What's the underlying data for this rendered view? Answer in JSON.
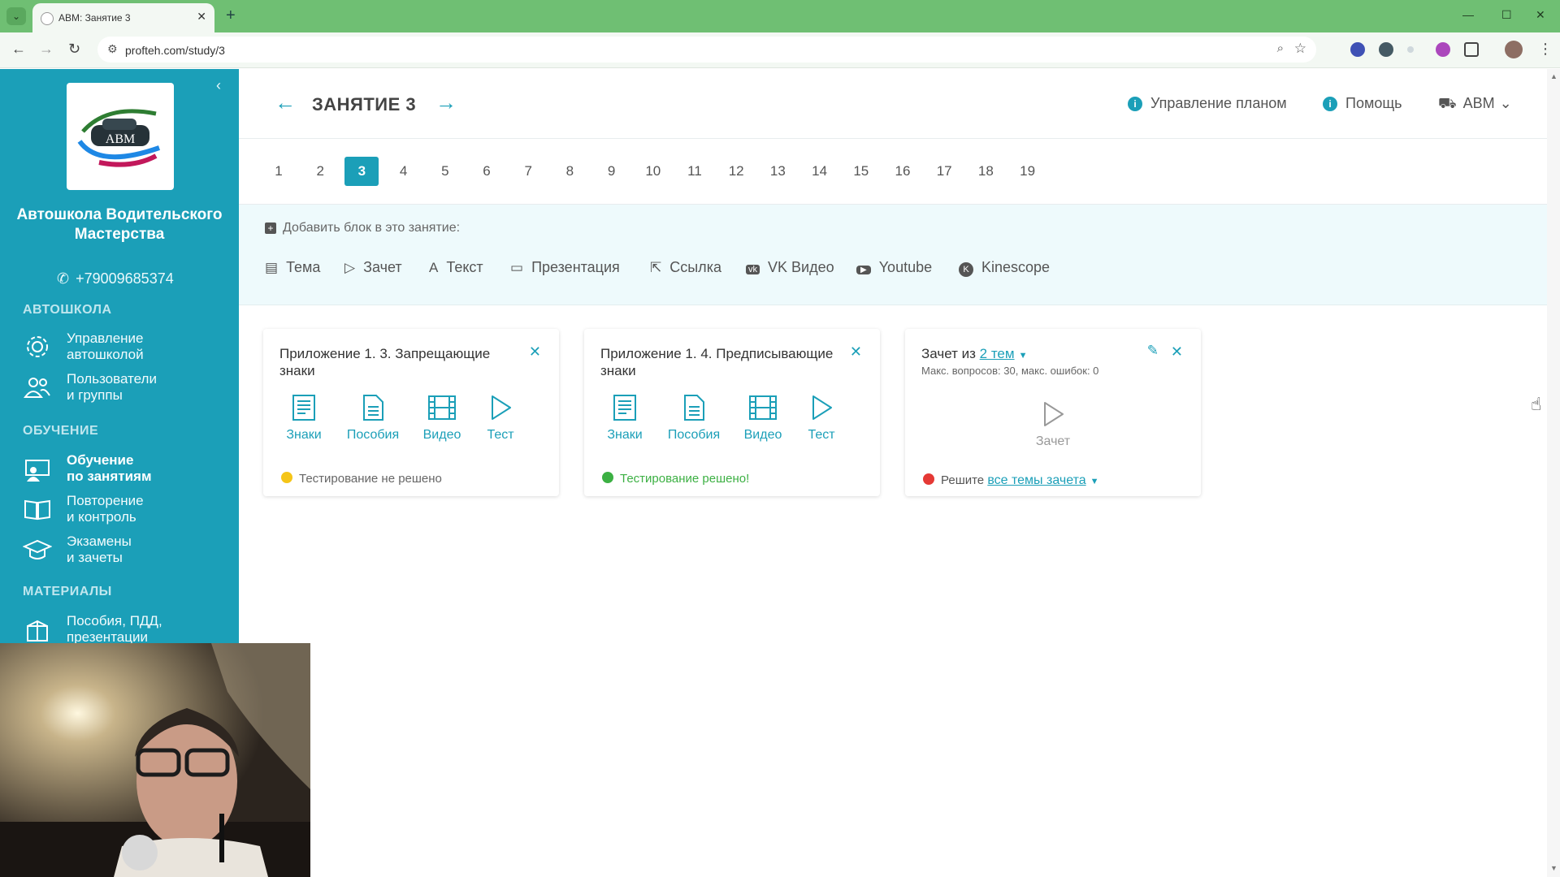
{
  "browser": {
    "tab_title": "АВМ: Занятие 3",
    "url": "profteh.com/study/3"
  },
  "sidebar": {
    "logo_text": "АВМ",
    "school_name": "Автошкола Водительского Мастерства",
    "phone": "+79009685374",
    "sections": [
      {
        "title": "АВТОШКОЛА",
        "items": [
          {
            "label": "Управление\nавтошколой",
            "icon": "gear-icon"
          },
          {
            "label": "Пользователи\nи группы",
            "icon": "users-icon"
          }
        ]
      },
      {
        "title": "ОБУЧЕНИЕ",
        "items": [
          {
            "label": "Обучение\nпо занятиям",
            "icon": "teacher-icon",
            "active": true
          },
          {
            "label": "Повторение\nи контроль",
            "icon": "book-open-icon"
          },
          {
            "label": "Экзамены\nи зачеты",
            "icon": "graduation-cap-icon"
          }
        ]
      },
      {
        "title": "МАТЕРИАЛЫ",
        "items": [
          {
            "label": "Пособия, ПДД,\nпрезентации",
            "icon": "box-icon"
          }
        ]
      }
    ]
  },
  "header": {
    "lesson_title": "ЗАНЯТИЕ 3",
    "plan_link": "Управление планом",
    "help_link": "Помощь",
    "account": "АВМ"
  },
  "pager": {
    "pages": [
      "1",
      "2",
      "3",
      "4",
      "5",
      "6",
      "7",
      "8",
      "9",
      "10",
      "11",
      "12",
      "13",
      "14",
      "15",
      "16",
      "17",
      "18",
      "19"
    ],
    "current": "3"
  },
  "add_block": {
    "title": "Добавить блок в это занятие:",
    "types": [
      "Тема",
      "Зачет",
      "Текст",
      "Презентация",
      "Ссылка",
      "VK Видео",
      "Youtube",
      "Kinescope"
    ]
  },
  "cards": [
    {
      "title": "Приложение 1. 3. Запрещающие знаки",
      "materials": [
        "Знаки",
        "Пособия",
        "Видео",
        "Тест"
      ],
      "status": "Тестирование не решено",
      "status_color": "#f5c518"
    },
    {
      "title": "Приложение 1. 4. Предписывающие знаки",
      "materials": [
        "Знаки",
        "Пособия",
        "Видео",
        "Тест"
      ],
      "status": "Тестирование решено!",
      "status_color": "#3cb043"
    },
    {
      "title_prefix": "Зачет из",
      "title_link": "2 тем",
      "subtitle": "Макс. вопросов: 30, макс. ошибок: 0",
      "action": "Зачет",
      "status_prefix": "Решите",
      "status_link": "все темы зачета",
      "status_color": "#e53935"
    }
  ],
  "colors": {
    "accent": "#1b9fb8",
    "tab_strip": "#6fbf73"
  }
}
